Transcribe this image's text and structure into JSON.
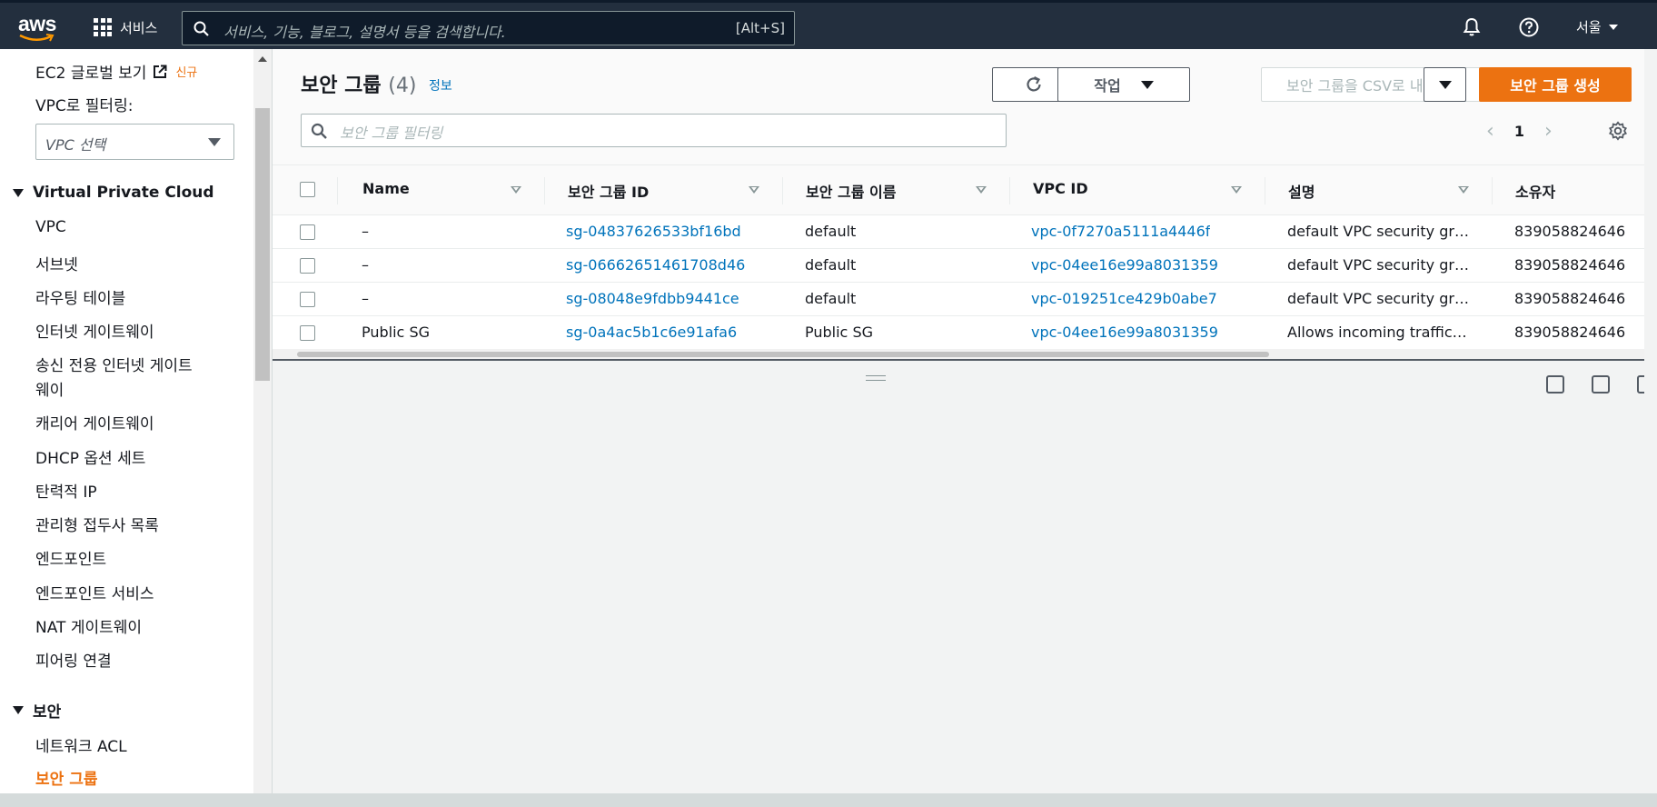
{
  "topnav": {
    "logo": "aws",
    "services_label": "서비스",
    "search_placeholder": "서비스, 기능, 블로그, 설명서 등을 검색합니다.",
    "search_shortcut": "[Alt+S]",
    "region": "서울"
  },
  "sidebar": {
    "global_view": "EC2 글로벌 보기",
    "global_view_badge": "신규",
    "vpc_filter_label": "VPC로 필터링:",
    "vpc_select_value": "VPC 선택",
    "section_vpc": "Virtual Private Cloud",
    "items": [
      "VPC",
      "서브넷",
      "라우팅 테이블",
      "인터넷 게이트웨이",
      "송신 전용 인터넷 게이트",
      "웨이",
      "캐리어 게이트웨이",
      "DHCP 옵션 세트",
      "탄력적 IP",
      "관리형 접두사 목록",
      "엔드포인트",
      "엔드포인트 서비스",
      "NAT 게이트웨이",
      "피어링 연결"
    ],
    "section_security": "보안",
    "security_items": [
      "네트워크 ACL",
      "보안 그룹"
    ]
  },
  "main": {
    "title": "보안 그룹",
    "count": "(4)",
    "info": "정보",
    "actions_label": "작업",
    "export_label": "보안 그룹을 CSV로 내보내기",
    "create_label": "보안 그룹 생성",
    "filter_placeholder": "보안 그룹 필터링",
    "page": "1"
  },
  "table": {
    "columns": [
      "Name",
      "보안 그룹 ID",
      "보안 그룹 이름",
      "VPC ID",
      "설명",
      "소유자"
    ],
    "rows": [
      {
        "name": "–",
        "id": "sg-04837626533bf16bd",
        "group_name": "default",
        "vpc": "vpc-0f7270a5111a4446f",
        "desc": "default VPC security gr…",
        "owner": "839058824646"
      },
      {
        "name": "–",
        "id": "sg-06662651461708d46",
        "group_name": "default",
        "vpc": "vpc-04ee16e99a8031359",
        "desc": "default VPC security gr…",
        "owner": "839058824646"
      },
      {
        "name": "–",
        "id": "sg-08048e9fdbb9441ce",
        "group_name": "default",
        "vpc": "vpc-019251ce429b0abe7",
        "desc": "default VPC security gr…",
        "owner": "839058824646"
      },
      {
        "name": "Public SG",
        "id": "sg-0a4ac5b1c6e91afa6",
        "group_name": "Public SG",
        "vpc": "vpc-04ee16e99a8031359",
        "desc": "Allows incoming traffic…",
        "owner": "839058824646"
      }
    ]
  },
  "colors": {
    "nav_bg": "#232f3e",
    "accent": "#ec7211",
    "link": "#0073bb"
  }
}
